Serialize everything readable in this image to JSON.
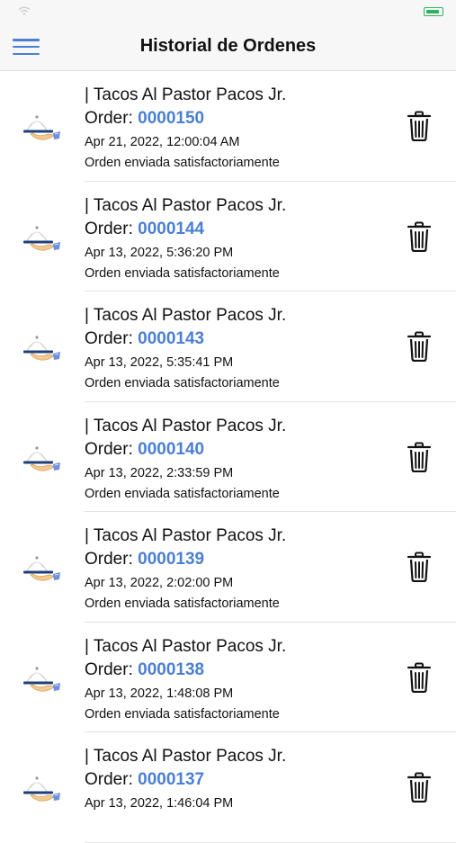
{
  "statusbar": {
    "carrier": "",
    "time": "",
    "battery": ""
  },
  "header": {
    "title": "Historial de Ordenes"
  },
  "icons": {
    "menu": "hamburger-menu-icon",
    "thumb": "serving-cloche-icon",
    "delete": "trash-icon"
  },
  "colors": {
    "accent": "#4a7fd4",
    "battery": "#2fb35a"
  },
  "orders": [
    {
      "shop": "| Tacos Al Pastor Pacos Jr.",
      "order_label": "Order: ",
      "order_number": "0000150",
      "date": "Apr 21, 2022, 12:00:04 AM",
      "status": "Orden enviada satisfactoriamente"
    },
    {
      "shop": "| Tacos Al Pastor Pacos Jr.",
      "order_label": "Order: ",
      "order_number": "0000144",
      "date": "Apr 13, 2022, 5:36:20 PM",
      "status": "Orden enviada satisfactoriamente"
    },
    {
      "shop": "| Tacos Al Pastor Pacos Jr.",
      "order_label": "Order: ",
      "order_number": "0000143",
      "date": "Apr 13, 2022, 5:35:41 PM",
      "status": "Orden enviada satisfactoriamente"
    },
    {
      "shop": "| Tacos Al Pastor Pacos Jr.",
      "order_label": "Order: ",
      "order_number": "0000140",
      "date": "Apr 13, 2022, 2:33:59 PM",
      "status": "Orden enviada satisfactoriamente"
    },
    {
      "shop": "| Tacos Al Pastor Pacos Jr.",
      "order_label": "Order: ",
      "order_number": "0000139",
      "date": "Apr 13, 2022, 2:02:00 PM",
      "status": "Orden enviada satisfactoriamente"
    },
    {
      "shop": "| Tacos Al Pastor Pacos Jr.",
      "order_label": "Order: ",
      "order_number": "0000138",
      "date": "Apr 13, 2022, 1:48:08 PM",
      "status": "Orden enviada satisfactoriamente"
    },
    {
      "shop": "| Tacos Al Pastor Pacos Jr.",
      "order_label": "Order: ",
      "order_number": "0000137",
      "date": "Apr 13, 2022, 1:46:04 PM",
      "status": ""
    }
  ]
}
